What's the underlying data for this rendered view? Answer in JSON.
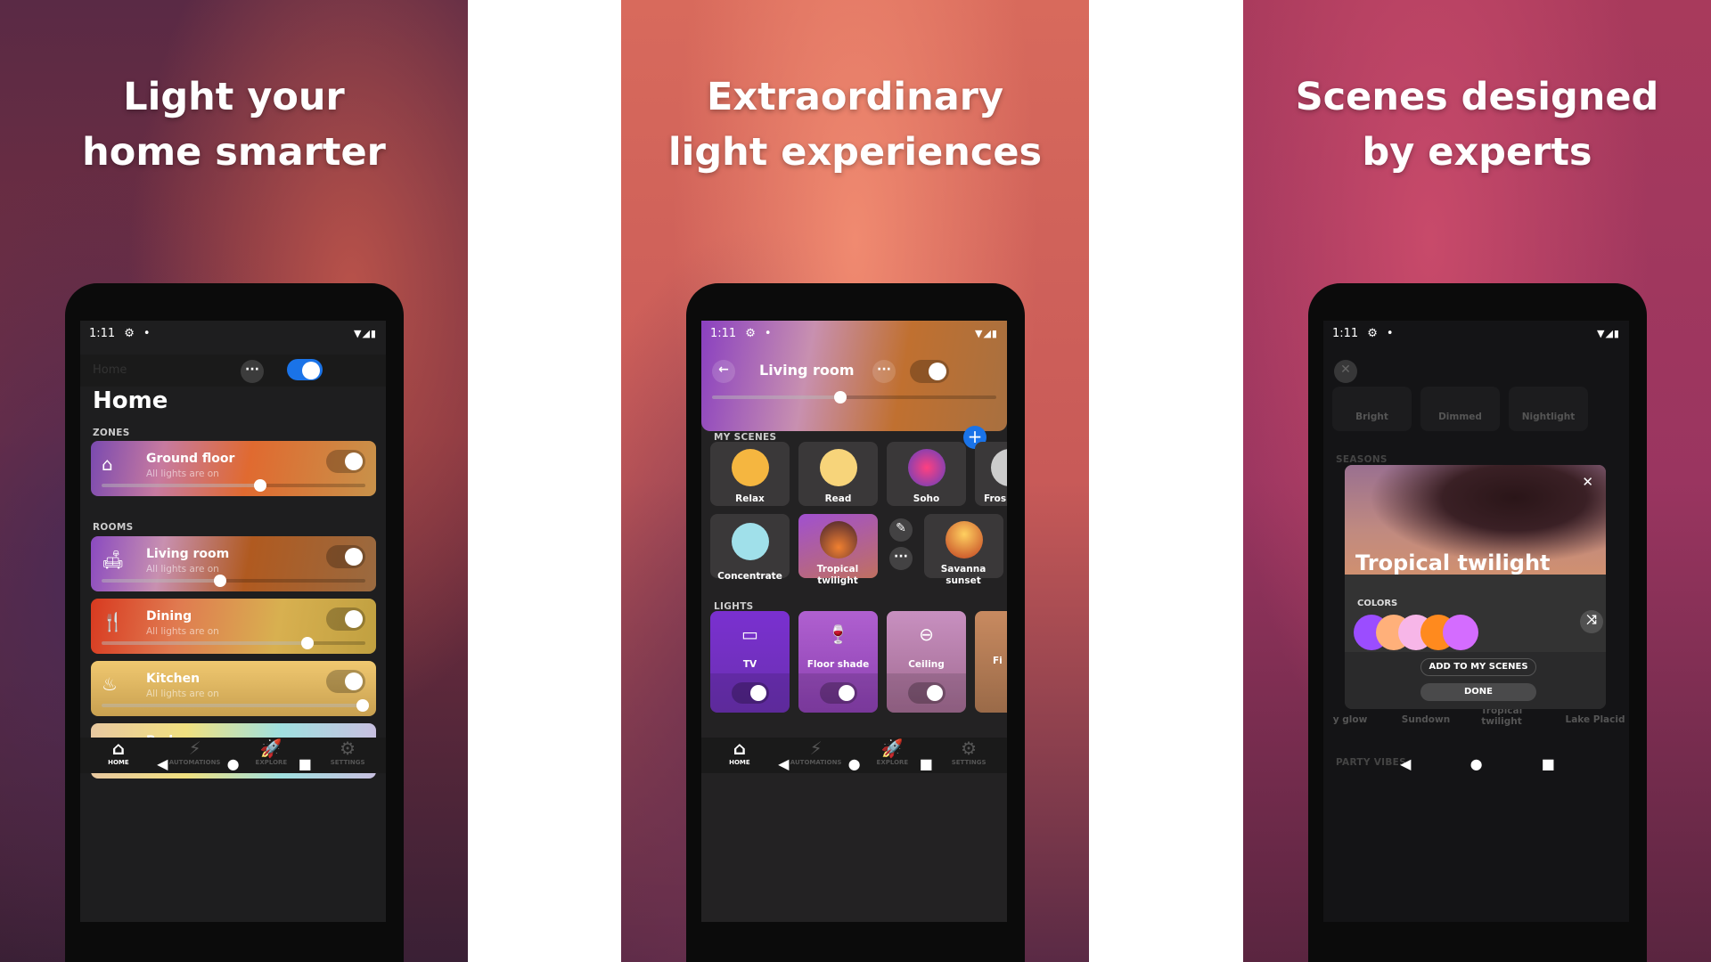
{
  "panels": [
    {
      "headline": [
        "Light your",
        "home smarter"
      ]
    },
    {
      "headline": [
        "Extraordinary",
        "light experiences"
      ]
    },
    {
      "headline": [
        "Scenes designed",
        "by experts"
      ]
    }
  ],
  "status_bar": {
    "time": "1:11",
    "icons": [
      "gear-icon",
      "dot-icon",
      "wifi-icon",
      "signal-icon",
      "battery-icon"
    ]
  },
  "home_screen": {
    "header_faded_title": "Home",
    "title": "Home",
    "master_toggle": true,
    "accent": "#1a73e8",
    "zones_label": "ZONES",
    "zones": [
      {
        "name": "Ground floor",
        "status": "All lights are on",
        "brightness": 0.6,
        "icon": "house-icon",
        "on": true
      }
    ],
    "rooms_label": "ROOMS",
    "rooms": [
      {
        "name": "Living room",
        "status": "All lights are on",
        "brightness": 0.45,
        "icon": "sofa-icon",
        "on": true
      },
      {
        "name": "Dining",
        "status": "All lights are on",
        "brightness": 0.78,
        "icon": "cutlery-icon",
        "on": true
      },
      {
        "name": "Kitchen",
        "status": "All lights are on",
        "brightness": 0.99,
        "icon": "pot-icon",
        "on": true
      },
      {
        "name": "Bed...",
        "status": "",
        "partial": true
      }
    ]
  },
  "bottom_nav": [
    {
      "label": "HOME",
      "icon": "home-icon",
      "active": true
    },
    {
      "label": "AUTOMATIONS",
      "icon": "lightning-icon",
      "active": false
    },
    {
      "label": "EXPLORE",
      "icon": "rocket-icon",
      "active": false
    },
    {
      "label": "SETTINGS",
      "icon": "gear-icon",
      "active": false
    }
  ],
  "room_screen": {
    "title": "Living room",
    "brightness": 0.45,
    "on": true,
    "my_scenes_label": "MY SCENES",
    "scenes": [
      {
        "name": "Relax"
      },
      {
        "name": "Read"
      },
      {
        "name": "Soho"
      },
      {
        "name": "Fros"
      },
      {
        "name": "Concentrate"
      },
      {
        "name": "Tropical twilight",
        "active": true
      },
      {
        "name": "Savanna sunset"
      }
    ],
    "lights_label": "LIGHTS",
    "lights": [
      {
        "name": "TV",
        "icon": "lightbar-icon",
        "on": true
      },
      {
        "name": "Floor shade",
        "icon": "floor-lamp-icon",
        "on": true
      },
      {
        "name": "Ceiling",
        "icon": "ceiling-light-icon",
        "on": true
      },
      {
        "name": "Fi",
        "on": true
      }
    ]
  },
  "gallery_screen": {
    "bg_scenes": [
      "Bright",
      "Dimmed",
      "Nightlight"
    ],
    "seasons_label": "SEASONS",
    "bg_bottom_scenes": [
      "y glow",
      "Sundown",
      "Tropical twilight",
      "Lake Placid"
    ],
    "party_label": "PARTY VIBES",
    "modal": {
      "title": "Tropical twilight",
      "colors_label": "COLORS",
      "colors": [
        "#9b4dff",
        "#ffb07a",
        "#f7b6e8",
        "#ff8a1e",
        "#d46cff"
      ],
      "add_button": "ADD TO MY SCENES",
      "done_button": "DONE"
    }
  }
}
